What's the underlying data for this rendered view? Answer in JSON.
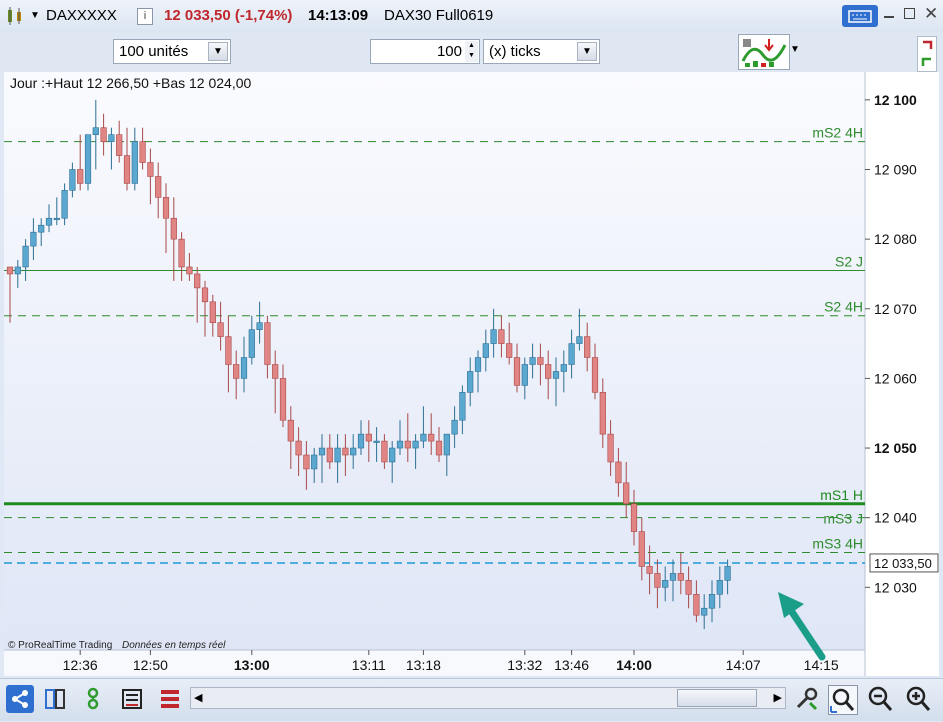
{
  "window": {
    "symbol": "DAXXXXX",
    "price_change": "12 033,50 (-1,74%)",
    "time": "14:13:09",
    "instrument": "DAX30 Full0619"
  },
  "toolbar": {
    "units_value": "100 unités",
    "ticks_value": "100",
    "ticks_mode": "(x) ticks"
  },
  "chart_data": {
    "type": "candlestick",
    "header": "Jour :+Haut 12 266,50 +Bas 12 024,00",
    "watermark_brand": "© ProRealTime Trading",
    "watermark_rt": "Données en temps réel",
    "ylim": [
      12021,
      12104
    ],
    "yticks": [
      "12 100",
      "12 090",
      "12 080",
      "12 070",
      "12 060",
      "12 050",
      "12 040",
      "12 030"
    ],
    "ytick_values": [
      12100,
      12090,
      12080,
      12070,
      12060,
      12050,
      12040,
      12030
    ],
    "bold_yticks": [
      12100,
      12050
    ],
    "xticks": [
      {
        "label": "12:36",
        "index": 9,
        "bold": false
      },
      {
        "label": "12:50",
        "index": 18,
        "bold": false
      },
      {
        "label": "13:00",
        "index": 31,
        "bold": true
      },
      {
        "label": "13:11",
        "index": 46,
        "bold": false
      },
      {
        "label": "13:18",
        "index": 53,
        "bold": false
      },
      {
        "label": "13:32",
        "index": 66,
        "bold": false
      },
      {
        "label": "13:46",
        "index": 72,
        "bold": false
      },
      {
        "label": "14:00",
        "index": 80,
        "bold": true
      },
      {
        "label": "14:07",
        "index": 94,
        "bold": false
      },
      {
        "label": "14:15",
        "index": 104,
        "bold": false
      }
    ],
    "levels": [
      {
        "name": "mS2 4H",
        "value": 12094,
        "style": "dashed",
        "color": "#2e8b2e"
      },
      {
        "name": "S2 J",
        "value": 12075.5,
        "style": "solid",
        "color": "#2e8b2e"
      },
      {
        "name": "S2 4H",
        "value": 12069,
        "style": "dashed",
        "color": "#2e8b2e"
      },
      {
        "name": "mS1 H",
        "value": 12042,
        "style": "thick",
        "color": "#1f8a1f"
      },
      {
        "name": "mS3 J",
        "value": 12040,
        "style": "dashed",
        "color": "#2e8b2e"
      },
      {
        "name": "mS3 4H",
        "value": 12035,
        "style": "dashed",
        "color": "#2e8b2e"
      }
    ],
    "last_price": {
      "label": "12 033,50",
      "value": 12033.5
    },
    "candles": [
      [
        12076,
        12076,
        12068,
        12075
      ],
      [
        12075,
        12077,
        12073,
        12076
      ],
      [
        12076,
        12080,
        12074,
        12079
      ],
      [
        12079,
        12083,
        12077,
        12081
      ],
      [
        12081,
        12083,
        12079,
        12082
      ],
      [
        12082,
        12085,
        12081,
        12083
      ],
      [
        12083,
        12086,
        12082,
        12083
      ],
      [
        12083,
        12088,
        12082,
        12087
      ],
      [
        12087,
        12091,
        12086,
        12090
      ],
      [
        12090,
        12095,
        12087,
        12088
      ],
      [
        12088,
        12095,
        12087,
        12095
      ],
      [
        12095,
        12100,
        12090,
        12096
      ],
      [
        12096,
        12098,
        12092,
        12094
      ],
      [
        12094,
        12096,
        12090,
        12095
      ],
      [
        12095,
        12097,
        12091,
        12092
      ],
      [
        12092,
        12096,
        12087,
        12088
      ],
      [
        12088,
        12096,
        12087,
        12094
      ],
      [
        12094,
        12096,
        12090,
        12091
      ],
      [
        12091,
        12093,
        12085,
        12089
      ],
      [
        12089,
        12091,
        12083,
        12086
      ],
      [
        12086,
        12088,
        12078,
        12083
      ],
      [
        12083,
        12086,
        12074,
        12080
      ],
      [
        12080,
        12081,
        12074,
        12076
      ],
      [
        12076,
        12078,
        12074,
        12075
      ],
      [
        12075,
        12076,
        12068,
        12073
      ],
      [
        12073,
        12074,
        12066,
        12071
      ],
      [
        12071,
        12072,
        12066,
        12068
      ],
      [
        12068,
        12071,
        12064,
        12066
      ],
      [
        12066,
        12069,
        12058,
        12062
      ],
      [
        12062,
        12064,
        12057,
        12060
      ],
      [
        12060,
        12066,
        12058,
        12063
      ],
      [
        12063,
        12069,
        12062,
        12067
      ],
      [
        12067,
        12071,
        12065,
        12068
      ],
      [
        12068,
        12069,
        12060,
        12062
      ],
      [
        12062,
        12064,
        12055,
        12060
      ],
      [
        12060,
        12062,
        12053,
        12054
      ],
      [
        12054,
        12056,
        12047,
        12051
      ],
      [
        12051,
        12053,
        12046,
        12049
      ],
      [
        12049,
        12051,
        12044,
        12047
      ],
      [
        12047,
        12050,
        12045,
        12049
      ],
      [
        12049,
        12052,
        12045,
        12050
      ],
      [
        12050,
        12052,
        12047,
        12048
      ],
      [
        12048,
        12052,
        12045,
        12050
      ],
      [
        12050,
        12052,
        12046,
        12049
      ],
      [
        12049,
        12052,
        12047,
        12050
      ],
      [
        12050,
        12054,
        12049,
        12052
      ],
      [
        12052,
        12054,
        12048,
        12051
      ],
      [
        12051,
        12053,
        12048,
        12051
      ],
      [
        12051,
        12052,
        12047,
        12048
      ],
      [
        12048,
        12051,
        12045,
        12050
      ],
      [
        12050,
        12054,
        12049,
        12051
      ],
      [
        12051,
        12055,
        12048,
        12050
      ],
      [
        12050,
        12052,
        12047,
        12051
      ],
      [
        12051,
        12056,
        12050,
        12052
      ],
      [
        12052,
        12055,
        12049,
        12051
      ],
      [
        12051,
        12053,
        12048,
        12049
      ],
      [
        12049,
        12052,
        12046,
        12052
      ],
      [
        12052,
        12056,
        12050,
        12054
      ],
      [
        12054,
        12059,
        12052,
        12058
      ],
      [
        12058,
        12063,
        12056,
        12061
      ],
      [
        12061,
        12064,
        12058,
        12063
      ],
      [
        12063,
        12067,
        12061,
        12065
      ],
      [
        12065,
        12070,
        12063,
        12067
      ],
      [
        12067,
        12069,
        12063,
        12065
      ],
      [
        12065,
        12068,
        12062,
        12063
      ],
      [
        12063,
        12065,
        12058,
        12059
      ],
      [
        12059,
        12063,
        12057,
        12062
      ],
      [
        12062,
        12065,
        12060,
        12063
      ],
      [
        12063,
        12065,
        12059,
        12062
      ],
      [
        12062,
        12064,
        12057,
        12060
      ],
      [
        12060,
        12063,
        12056,
        12061
      ],
      [
        12061,
        12064,
        12058,
        12062
      ],
      [
        12062,
        12067,
        12060,
        12065
      ],
      [
        12065,
        12070,
        12064,
        12066
      ],
      [
        12066,
        12068,
        12061,
        12063
      ],
      [
        12063,
        12065,
        12057,
        12058
      ],
      [
        12058,
        12060,
        12050,
        12052
      ],
      [
        12052,
        12054,
        12046,
        12048
      ],
      [
        12048,
        12050,
        12043,
        12045
      ],
      [
        12045,
        12048,
        12040,
        12042
      ],
      [
        12042,
        12044,
        12036,
        12038
      ],
      [
        12038,
        12040,
        12031,
        12033
      ],
      [
        12033,
        12036,
        12029,
        12032
      ],
      [
        12032,
        12034,
        12027,
        12030
      ],
      [
        12030,
        12033,
        12028,
        12031
      ],
      [
        12031,
        12034,
        12028,
        12032
      ],
      [
        12032,
        12035,
        12029,
        12031
      ],
      [
        12031,
        12033,
        12027,
        12029
      ],
      [
        12029,
        12031,
        12025,
        12026
      ],
      [
        12026,
        12029,
        12024,
        12027
      ],
      [
        12027,
        12031,
        12025,
        12029
      ],
      [
        12029,
        12033,
        12027,
        12031
      ],
      [
        12031,
        12034,
        12029,
        12033
      ]
    ]
  },
  "icons": [
    "candles-icon",
    "keyboard-icon",
    "minimize-icon",
    "maximize-icon",
    "close-icon",
    "strategy-icon",
    "share-icon",
    "layout-icon",
    "tools-icon",
    "list-icon",
    "bars-icon",
    "settings-icon",
    "zoom-icon",
    "zoom-out-icon",
    "zoom-in-icon"
  ]
}
